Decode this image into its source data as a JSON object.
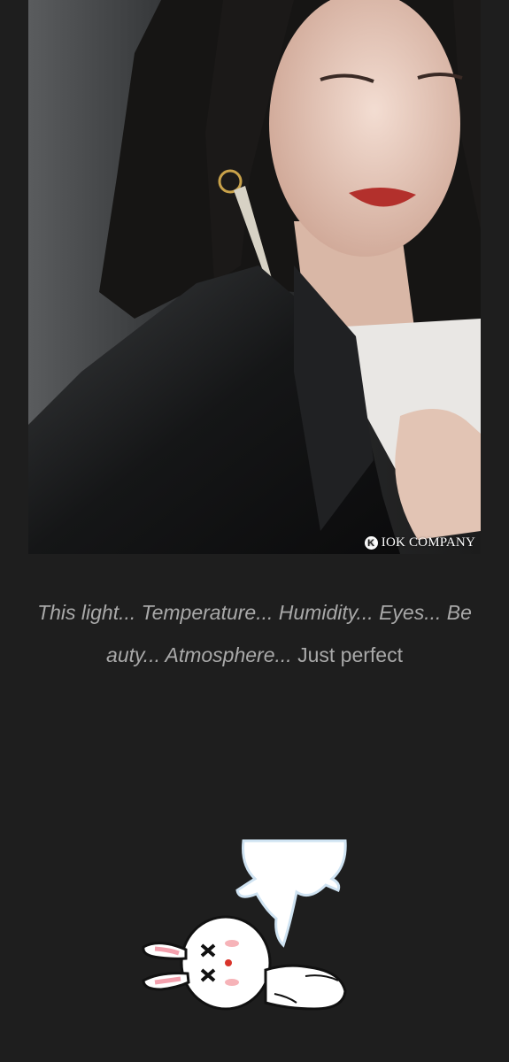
{
  "photo": {
    "watermark": "IOK COMPANY",
    "watermark_logo_letter": "K"
  },
  "caption": {
    "italic_part": "This light... Temperature... Humidity... Eyes... Beauty... Atmosphere...",
    "normal_part": " Just perfect"
  },
  "sticker": {
    "icon": "cony-rabbit-sticker-icon"
  },
  "colors": {
    "background": "#1e1e1e",
    "caption_text": "#a9a9a9"
  }
}
